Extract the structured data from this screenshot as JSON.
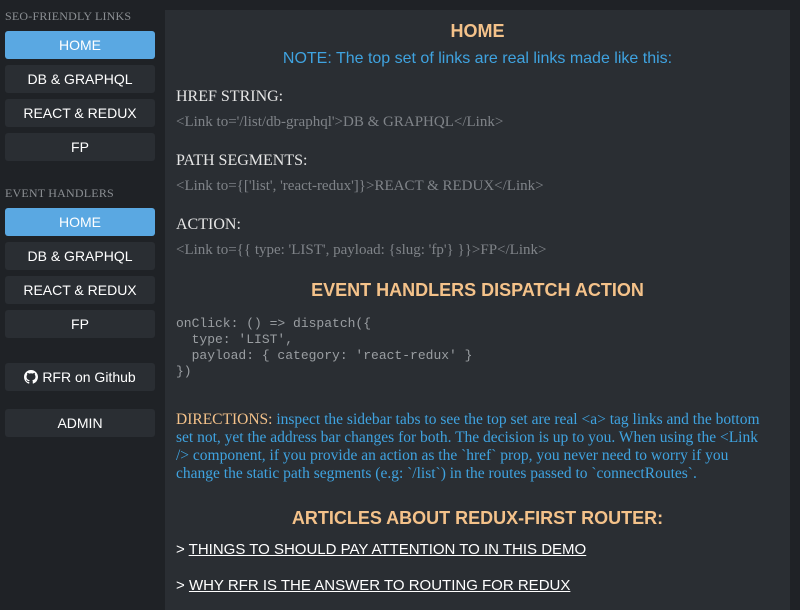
{
  "sidebar": {
    "seo_label": "SEO-FRIENDLY LINKS",
    "seo_links": [
      "HOME",
      "DB & GRAPHQL",
      "REACT & REDUX",
      "FP"
    ],
    "event_label": "EVENT HANDLERS",
    "event_links": [
      "HOME",
      "DB & GRAPHQL",
      "REACT & REDUX",
      "FP"
    ],
    "github_label": "RFR on Github",
    "github_icon": "github-icon",
    "admin_label": "ADMIN"
  },
  "main": {
    "title": "HOME",
    "note": "NOTE: The top set of links are real links made like this:",
    "href_label": "HREF STRING:",
    "href_code": "<Link to='/list/db-graphql'>DB & GRAPHQL</Link>",
    "path_label": "PATH SEGMENTS:",
    "path_code": "<Link to={['list', 'react-redux']}>REACT & REDUX</Link>",
    "action_label": "ACTION:",
    "action_code": "<Link to={{ type: 'LIST', payload: {slug: 'fp'} }}>FP</Link>",
    "event_title": "EVENT HANDLERS DISPATCH ACTION",
    "event_code": "onClick: () => dispatch({\n  type: 'LIST',\n  payload: { category: 'react-redux' }\n})",
    "directions_label": "DIRECTIONS:",
    "directions_text": " inspect the sidebar tabs to see the top set are real <a> tag links and the bottom set not, yet the address bar changes for both. The decision is up to you. When using the <Link /> component, if you provide an action as the `href` prop, you never need to worry if you change the static path segments (e.g: `/list`) in the routes passed to `connectRoutes`.",
    "articles_title": "ARTICLES ABOUT REDUX-FIRST ROUTER:",
    "articles": [
      "THINGS TO SHOULD PAY ATTENTION TO IN THIS DEMO",
      "WHY RFR IS THE ANSWER TO ROUTING FOR REDUX"
    ],
    "article_prefix": "> "
  },
  "colors": {
    "background": "#1f2226",
    "panel": "#2a2e33",
    "active": "#5aa8e2",
    "heading": "#f4c28a",
    "link_blue": "#3fa3e0"
  }
}
